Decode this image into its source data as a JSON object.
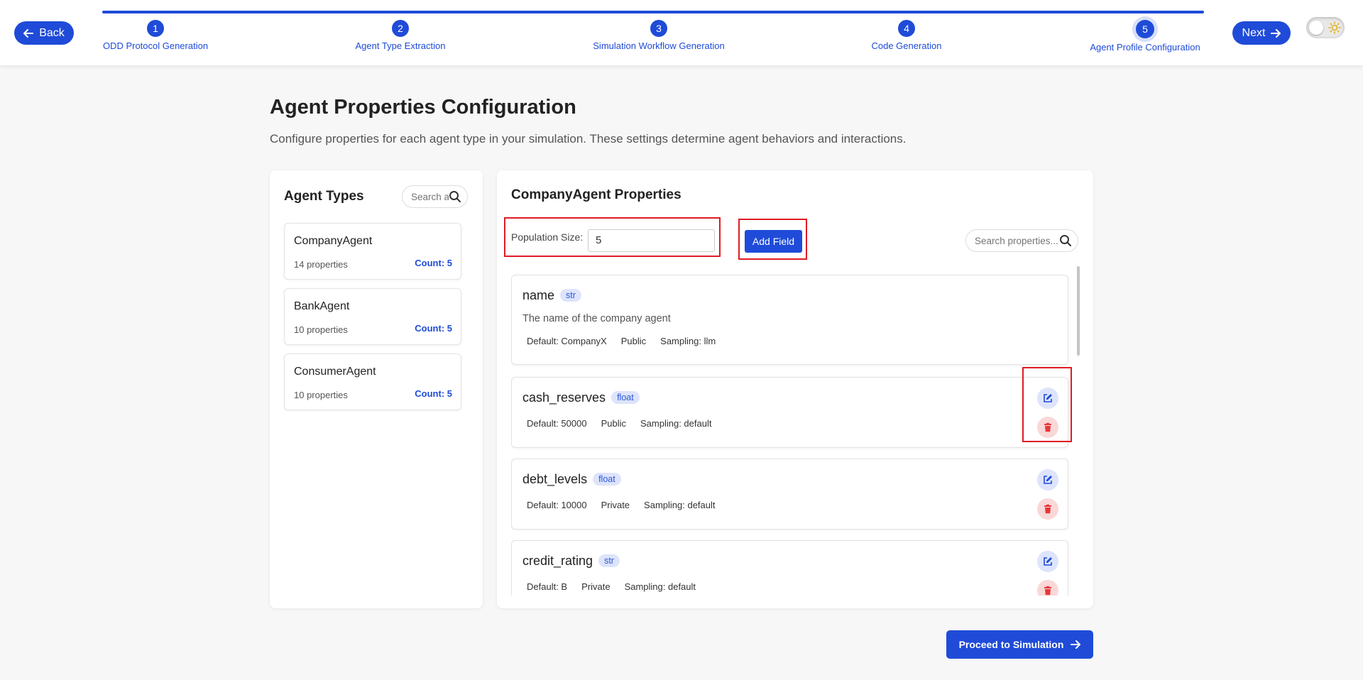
{
  "header": {
    "back_label": "Back",
    "next_label": "Next",
    "steps": [
      {
        "num": "1",
        "label": "ODD Protocol Generation"
      },
      {
        "num": "2",
        "label": "Agent Type Extraction"
      },
      {
        "num": "3",
        "label": "Simulation Workflow Generation"
      },
      {
        "num": "4",
        "label": "Code Generation"
      },
      {
        "num": "5",
        "label": "Agent Profile Configuration"
      }
    ],
    "active_step": 5,
    "accent_color": "#1f4bd8"
  },
  "page": {
    "title": "Agent Properties Configuration",
    "description": "Configure properties for each agent type in your simulation. These settings determine agent behaviors and interactions."
  },
  "agent_types": {
    "title": "Agent Types",
    "search_placeholder": "Search agent types...",
    "items": [
      {
        "name": "CompanyAgent",
        "properties": "14 properties",
        "count": "Count: 5"
      },
      {
        "name": "BankAgent",
        "properties": "10 properties",
        "count": "Count: 5"
      },
      {
        "name": "ConsumerAgent",
        "properties": "10 properties",
        "count": "Count: 5"
      }
    ]
  },
  "properties_panel": {
    "title": "CompanyAgent Properties",
    "population_label": "Population Size:",
    "population_value": "5",
    "add_field_label": "Add Field",
    "search_placeholder": "Search properties...",
    "items": [
      {
        "name": "name",
        "type": "str",
        "description": "The name of the company agent",
        "default": "Default: CompanyX",
        "visibility": "Public",
        "sampling": "Sampling: llm"
      },
      {
        "name": "cash_reserves",
        "type": "float",
        "description": "",
        "default": "Default: 50000",
        "visibility": "Public",
        "sampling": "Sampling: default"
      },
      {
        "name": "debt_levels",
        "type": "float",
        "description": "",
        "default": "Default: 10000",
        "visibility": "Private",
        "sampling": "Sampling: default"
      },
      {
        "name": "credit_rating",
        "type": "str",
        "description": "",
        "default": "Default: B",
        "visibility": "Private",
        "sampling": "Sampling: default"
      }
    ]
  },
  "footer": {
    "proceed_label": "Proceed to Simulation"
  },
  "icons": {
    "back": "arrow-left-icon",
    "next": "arrow-right-icon",
    "search": "search-icon",
    "edit": "edit-icon",
    "delete": "trash-icon",
    "theme": "sun-icon"
  }
}
